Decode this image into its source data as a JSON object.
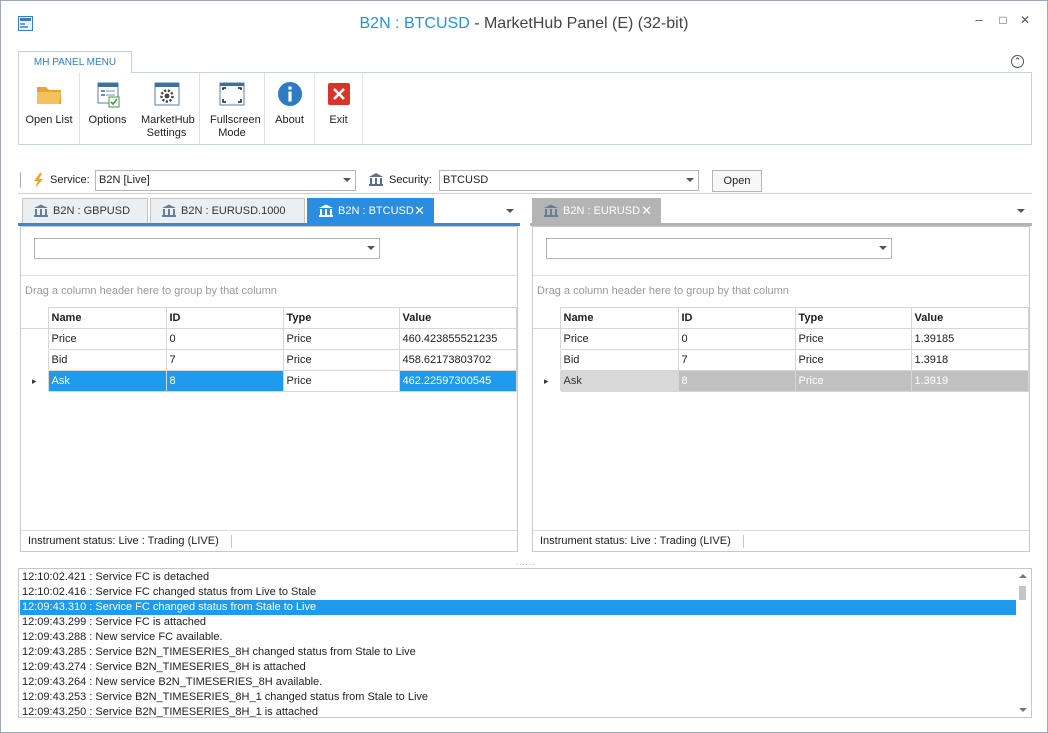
{
  "window": {
    "title_prefix": "B2N : BTCUSD",
    "title_suffix": " - MarketHub Panel (E) (32-bit)",
    "minimize": "–",
    "maximize": "□",
    "close": "✕"
  },
  "ribbon": {
    "tab_label": "MH PANEL MENU",
    "collapse_glyph": "⌃",
    "buttons": [
      {
        "icon": "folder-icon",
        "label": "Open List"
      },
      {
        "icon": "options-icon",
        "label": "Options"
      },
      {
        "icon": "settings-gear-icon",
        "label": "MarketHub Settings"
      },
      {
        "icon": "fullscreen-icon",
        "label": "Fullscreen Mode"
      },
      {
        "icon": "info-icon",
        "label": "About"
      },
      {
        "icon": "exit-icon",
        "label": "Exit"
      }
    ]
  },
  "service_bar": {
    "service_label": "Service:",
    "service_value": "B2N [Live]",
    "security_label": "Security:",
    "security_value": "BTCUSD",
    "open_button": "Open"
  },
  "left_tabs": [
    {
      "label": "B2N : GBPUSD",
      "close": ""
    },
    {
      "label": "B2N : EURUSD.1000",
      "close": ""
    },
    {
      "label": "B2N : BTCUSD",
      "close": "✕"
    }
  ],
  "right_tabs": [
    {
      "label": "B2N : EURUSD",
      "close": "✕"
    }
  ],
  "grid_common": {
    "group_hint": "Drag a column header here to group by that column",
    "columns": [
      "Name",
      "ID",
      "Type",
      "Value"
    ]
  },
  "left_grid": {
    "rows": [
      {
        "name": "Price",
        "id": "0",
        "type": "Price",
        "value": "460.423855521235"
      },
      {
        "name": "Bid",
        "id": "7",
        "type": "Price",
        "value": "458.62173803702"
      },
      {
        "name": "Ask",
        "id": "8",
        "type": "Price",
        "value": "462.22597300545"
      }
    ],
    "status": "Instrument status: Live : Trading (LIVE)",
    "row_indicator": "▸"
  },
  "right_grid": {
    "rows": [
      {
        "name": "Price",
        "id": "0",
        "type": "Price",
        "value": "1.39185"
      },
      {
        "name": "Bid",
        "id": "7",
        "type": "Price",
        "value": "1.3918"
      },
      {
        "name": "Ask",
        "id": "8",
        "type": "Price",
        "value": "1.3919"
      }
    ],
    "status": "Instrument status: Live : Trading (LIVE)",
    "row_indicator": "▸"
  },
  "splitter": "......",
  "log": [
    "12:10:02.421 : Service FC is detached",
    "12:10:02.416 : Service FC changed status from Live to Stale",
    "12:09:43.310 : Service FC changed status from Stale to Live",
    "12:09:43.299 : Service FC is attached",
    "12:09:43.288 : New service FC available.",
    "12:09:43.285 : Service B2N_TIMESERIES_8H changed status from Stale to Live",
    "12:09:43.274 : Service B2N_TIMESERIES_8H is attached",
    "12:09:43.264 : New service B2N_TIMESERIES_8H available.",
    "12:09:43.253 : Service B2N_TIMESERIES_8H_1 changed status from Stale to Live",
    "12:09:43.250 : Service B2N_TIMESERIES_8H_1 is attached"
  ],
  "colors": {
    "accent": "#2a8de0",
    "selection": "#1e9bef",
    "inactive_tab": "#b4b4b4"
  }
}
